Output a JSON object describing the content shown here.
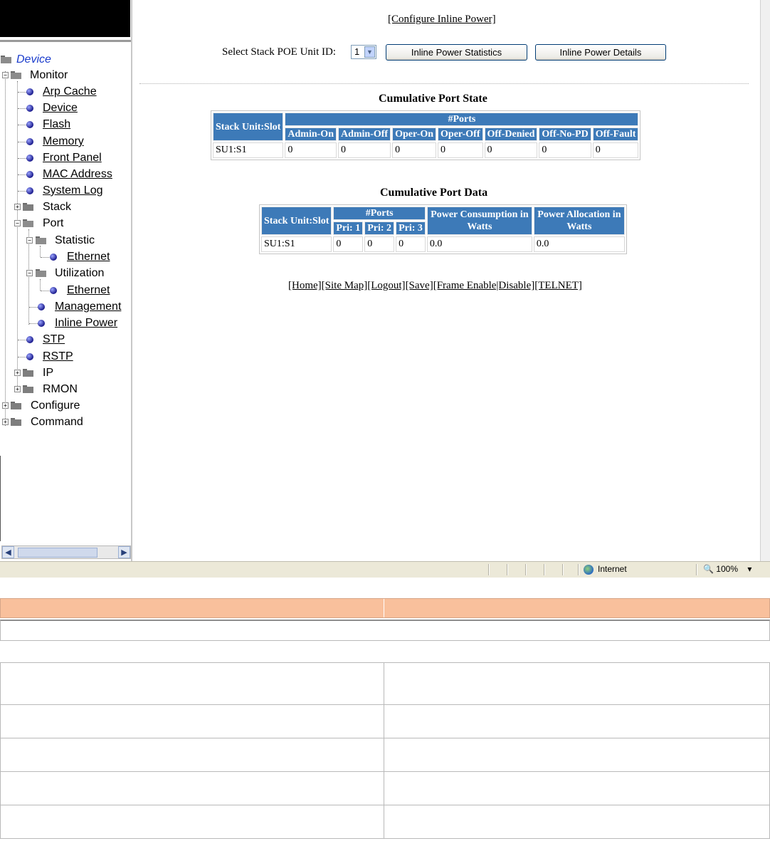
{
  "sidebar": {
    "tree": [
      {
        "label": "Device",
        "type": "root"
      },
      {
        "label": "Monitor",
        "type": "folder"
      },
      {
        "label": "Arp Cache",
        "type": "link"
      },
      {
        "label": "Device",
        "type": "link"
      },
      {
        "label": "Flash",
        "type": "link"
      },
      {
        "label": "Memory",
        "type": "link"
      },
      {
        "label": "Front Panel",
        "type": "link"
      },
      {
        "label": "MAC Address",
        "type": "link"
      },
      {
        "label": "System Log",
        "type": "link"
      },
      {
        "label": "Stack",
        "type": "folder"
      },
      {
        "label": "Port",
        "type": "folder"
      },
      {
        "label": "Statistic",
        "type": "folder"
      },
      {
        "label": "Ethernet",
        "type": "link"
      },
      {
        "label": "Utilization",
        "type": "folder"
      },
      {
        "label": "Ethernet",
        "type": "link"
      },
      {
        "label": "Management",
        "type": "link"
      },
      {
        "label": "Inline Power",
        "type": "link"
      },
      {
        "label": "STP",
        "type": "link"
      },
      {
        "label": "RSTP",
        "type": "link"
      },
      {
        "label": "IP",
        "type": "folder"
      },
      {
        "label": "RMON",
        "type": "folder"
      },
      {
        "label": "Configure",
        "type": "folder"
      },
      {
        "label": "Command",
        "type": "folder"
      }
    ]
  },
  "main": {
    "configure_link": "[Configure Inline Power]",
    "select_label": "Select Stack POE Unit ID:",
    "select_value": "1",
    "btn_stats": "Inline Power Statistics",
    "btn_details": "Inline Power Details",
    "state_title": "Cumulative Port State",
    "state_table": {
      "h_slot": "Stack Unit:Slot",
      "h_ports": "#Ports",
      "cols": [
        "Admin-On",
        "Admin-Off",
        "Oper-On",
        "Oper-Off",
        "Off-Denied",
        "Off-No-PD",
        "Off-Fault"
      ],
      "row": {
        "slot": "SU1:S1",
        "values": [
          "0",
          "0",
          "0",
          "0",
          "0",
          "0",
          "0"
        ]
      }
    },
    "data_title": "Cumulative Port Data",
    "data_table": {
      "h_slot": "Stack Unit:Slot",
      "h_ports": "#Ports",
      "cols": [
        "Pri: 1",
        "Pri: 2",
        "Pri: 3"
      ],
      "h_consumption": "Power Consumption in Watts",
      "h_allocation": "Power Allocation in Watts",
      "row": {
        "slot": "SU1:S1",
        "values": [
          "0",
          "0",
          "0"
        ],
        "consumption": "0.0",
        "allocation": "0.0"
      }
    },
    "footer_links": [
      "[Home]",
      "[Site Map]",
      "[Logout]",
      "[Save]",
      "[Frame Enable|Disable]",
      "[TELNET]"
    ]
  },
  "statusbar": {
    "zone": "Internet",
    "zoom": "100%"
  }
}
